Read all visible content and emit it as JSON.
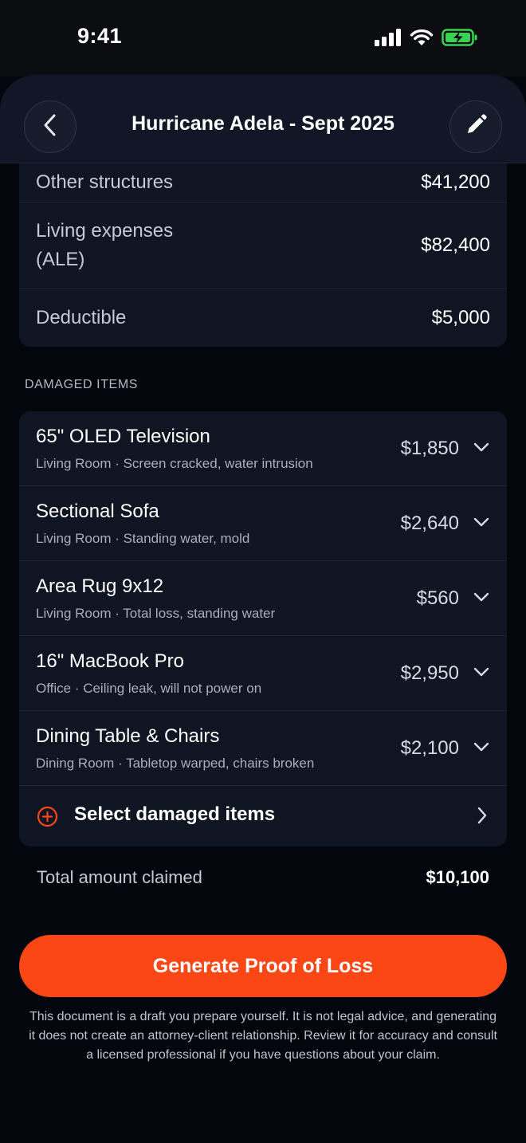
{
  "status_bar": {
    "time": "9:41",
    "icons": [
      "signal-icon",
      "wifi-icon",
      "battery-charging-icon"
    ],
    "battery_color": "#39d353"
  },
  "header": {
    "title": "Hurricane Adela - Sept 2025",
    "back_icon": "chevron-left-icon",
    "edit_icon": "pencil-icon"
  },
  "summary": [
    {
      "label": "Other structures",
      "value": "$41,200"
    },
    {
      "label": "Living expenses (ALE)",
      "value": "$82,400"
    },
    {
      "label": "Deductible",
      "value": "$5,000"
    }
  ],
  "damaged_items": {
    "section_label": "DAMAGED ITEMS",
    "items": [
      {
        "name": "65\" OLED Television",
        "detail": "Living Room · Screen cracked, water intrusion",
        "price": "$1,850"
      },
      {
        "name": "Sectional Sofa",
        "detail": "Living Room · Standing water, mold",
        "price": "$2,640"
      },
      {
        "name": "Area Rug 9x12",
        "detail": "Living Room · Total loss, standing water",
        "price": "$560"
      },
      {
        "name": "16\" MacBook Pro",
        "detail": "Office · Ceiling leak, will not power on",
        "price": "$2,950"
      },
      {
        "name": "Dining Table & Chairs",
        "detail": "Dining Room · Tabletop warped, chairs broken",
        "price": "$2,100"
      }
    ],
    "select_label": "Select damaged items"
  },
  "total": {
    "label": "Total amount claimed",
    "value": "$10,100"
  },
  "cta": {
    "label": "Generate Proof of Loss",
    "color": "#fb4715"
  },
  "disclaimer": "This document is a draft you prepare yourself. It is not legal advice, and generating it does not create an attorney-client relationship. Review it for accuracy and consult a licensed professional if you have questions about your claim.",
  "colors": {
    "background": "#04060d",
    "card": "#101524",
    "accent": "#fb4715"
  }
}
